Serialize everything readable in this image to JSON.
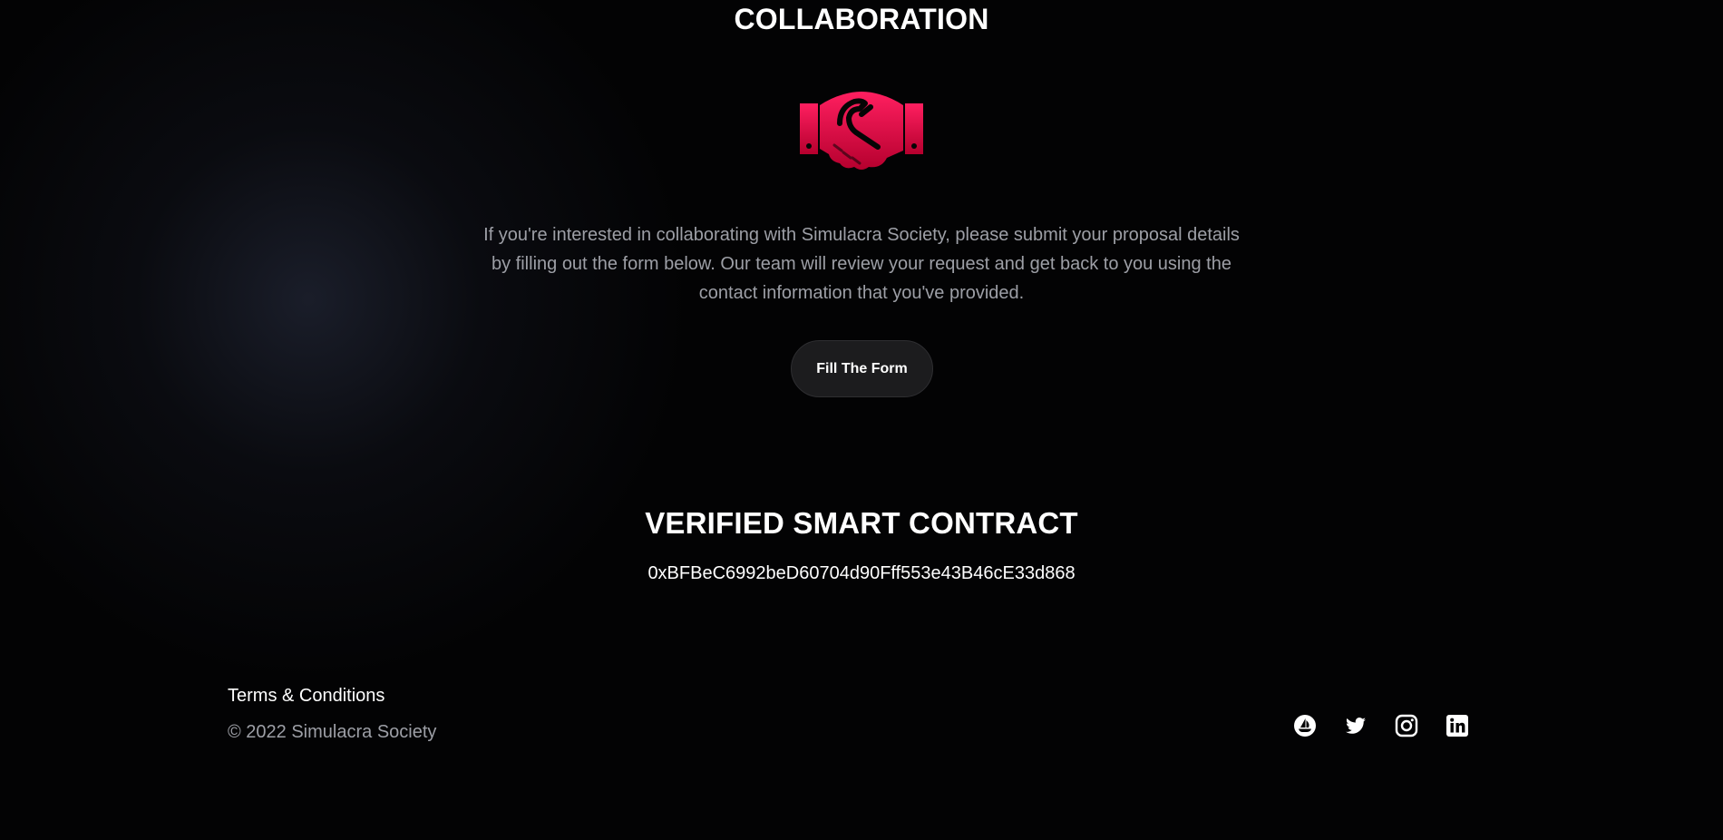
{
  "collaboration": {
    "title": "COLLABORATION",
    "icon": "handshake-icon",
    "description": "If you're interested in collaborating with Simulacra Society, please submit your proposal details by filling out the form below. Our team will review your request and get back to you using the contact information that you've provided.",
    "button_label": "Fill The Form"
  },
  "contract": {
    "title": "VERIFIED SMART CONTRACT",
    "address": "0xBFBeC6992beD60704d90Fff553e43B46cE33d868"
  },
  "footer": {
    "terms_label": "Terms & Conditions",
    "copyright": "© 2022 Simulacra Society",
    "social_icons": [
      "opensea-icon",
      "twitter-icon",
      "instagram-icon",
      "linkedin-icon"
    ]
  },
  "colors": {
    "background": "#030304",
    "accent_top": "#ff1a5e",
    "accent_bottom": "#b3002d",
    "text_primary": "#ffffff",
    "text_muted": "#9d9fa6",
    "button_bg": "#1c1c1e"
  }
}
